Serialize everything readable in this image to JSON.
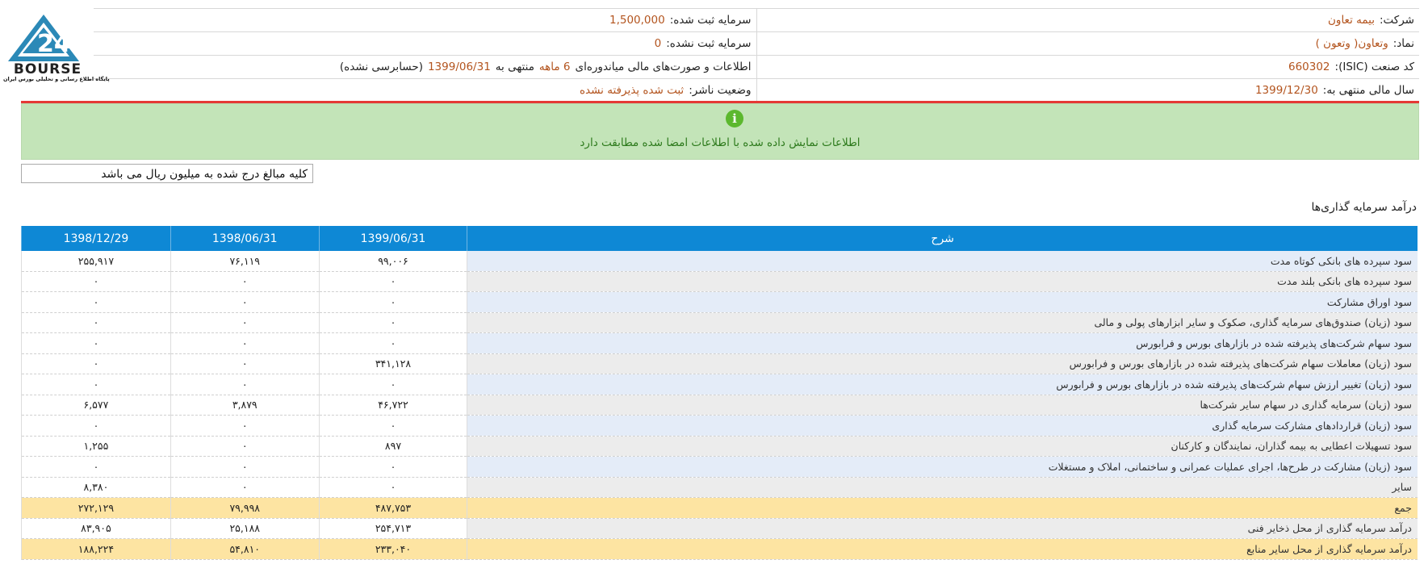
{
  "logo": {
    "main_text": "BOURSE",
    "number": "24",
    "caption": "پایگاه اطلاع رسانی و تحلیلی بورس ایران"
  },
  "info": {
    "company_label": "شرکت:",
    "company_value": "بیمه تعاون",
    "registered_capital_label": "سرمایه ثبت شده:",
    "registered_capital_value": "1,500,000",
    "symbol_label": "نماد:",
    "symbol_value": "وتعاون( وتعون )",
    "unregistered_capital_label": "سرمایه ثبت نشده:",
    "unregistered_capital_value": "0",
    "isic_label": "کد صنعت (ISIC):",
    "isic_value": "660302",
    "report_prefix": "اطلاعات و صورت‌های مالی میاندوره‌ای",
    "report_period": "6 ماهه",
    "report_mid": "منتهی به",
    "report_date": "1399/06/31",
    "report_suffix": "(حسابرسی نشده)",
    "fiscal_year_label": "سال مالی منتهی به:",
    "fiscal_year_value": "1399/12/30",
    "publisher_status_label": "وضعیت ناشر:",
    "publisher_status_value": "ثبت شده پذیرفته نشده"
  },
  "alert": {
    "icon": "info-icon",
    "message": "اطلاعات نمایش داده شده با اطلاعات امضا شده مطابقت دارد"
  },
  "unit_note": "کلیه مبالغ درج شده به میلیون ریال می باشد",
  "section_title": "درآمد سرمایه گذاری‌ها",
  "table": {
    "headers": [
      "شرح",
      "1399/06/31",
      "1398/06/31",
      "1398/12/29"
    ],
    "rows": [
      {
        "desc": "سود سپرده های بانکی کوتاه مدت",
        "v1": "۹۹,۰۰۶",
        "v2": "۷۶,۱۱۹",
        "v3": "۲۵۵,۹۱۷"
      },
      {
        "desc": "سود سپرده های بانکی بلند مدت",
        "v1": "۰",
        "v2": "۰",
        "v3": "۰"
      },
      {
        "desc": "سود اوراق مشارکت",
        "v1": "۰",
        "v2": "۰",
        "v3": "۰"
      },
      {
        "desc": "سود (زیان) صندوق‌های سرمایه گذاری، صکوک و سایر ابزارهای پولی و مالی",
        "v1": "۰",
        "v2": "۰",
        "v3": "۰"
      },
      {
        "desc": "سود سهام شرکت‌های پذیرفته شده در بازارهای بورس و فرابورس",
        "v1": "۰",
        "v2": "۰",
        "v3": "۰"
      },
      {
        "desc": "سود (زیان) معاملات سهام شرکت‌های پذیرفته شده در بازارهای بورس و فرابورس",
        "v1": "۳۴۱,۱۲۸",
        "v2": "۰",
        "v3": "۰"
      },
      {
        "desc": "سود (زیان) تغییر ارزش سهام شرکت‌های پذیرفته شده در بازارهای بورس و فرابورس",
        "v1": "۰",
        "v2": "۰",
        "v3": "۰"
      },
      {
        "desc": "سود (زیان) سرمایه گذاری در سهام سایر شرکت‌ها",
        "v1": "۴۶,۷۲۲",
        "v2": "۳,۸۷۹",
        "v3": "۶,۵۷۷"
      },
      {
        "desc": "سود (زیان) قراردادهای مشارکت سرمایه گذاری",
        "v1": "۰",
        "v2": "۰",
        "v3": "۰"
      },
      {
        "desc": "سود تسهیلات اعطایی به بیمه گذاران، نمایندگان و کارکنان",
        "v1": "۸۹۷",
        "v2": "۰",
        "v3": "۱,۲۵۵"
      },
      {
        "desc": "سود (زیان) مشارکت در طرح‌ها، اجرای عملیات عمرانی و ساختمانی، املاک و مستغلات",
        "v1": "۰",
        "v2": "۰",
        "v3": "۰"
      },
      {
        "desc": "سایر",
        "v1": "۰",
        "v2": "۰",
        "v3": "۸,۳۸۰"
      },
      {
        "desc": "جمع",
        "v1": "۴۸۷,۷۵۳",
        "v2": "۷۹,۹۹۸",
        "v3": "۲۷۲,۱۲۹",
        "total": true
      },
      {
        "desc": "درآمد سرمایه گذاری از محل ذخایر فنی",
        "v1": "۲۵۴,۷۱۳",
        "v2": "۲۵,۱۸۸",
        "v3": "۸۳,۹۰۵"
      },
      {
        "desc": "درآمد سرمایه گذاری از محل سایر منابع",
        "v1": "۲۳۳,۰۴۰",
        "v2": "۵۴,۸۱۰",
        "v3": "۱۸۸,۲۲۴",
        "total": true
      }
    ]
  }
}
